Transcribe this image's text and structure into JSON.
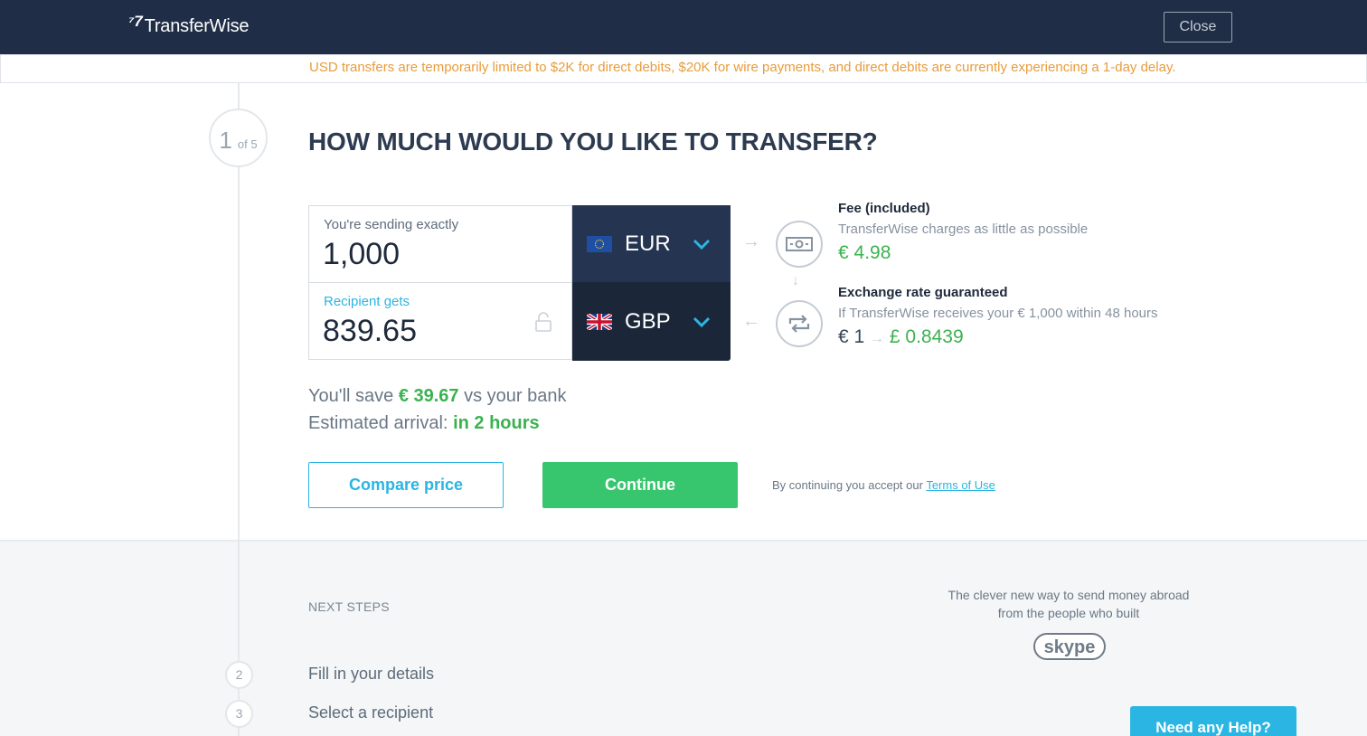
{
  "header": {
    "logo_mark": "⁷7",
    "logo_text": "TransferWise",
    "close_label": "Close"
  },
  "notice": "USD transfers are temporarily limited to $2K for direct debits, $20K for wire payments, and direct debits are currently experiencing a 1-day delay.",
  "step": {
    "current": "1",
    "of": "of 5"
  },
  "heading": "HOW MUCH WOULD YOU LIKE TO TRANSFER?",
  "calculator": {
    "send_label": "You're sending exactly",
    "send_amount": "1,000",
    "send_currency": "EUR",
    "recv_label": "Recipient gets",
    "recv_amount": "839.65",
    "recv_currency": "GBP"
  },
  "fee": {
    "title": "Fee (included)",
    "subtitle": "TransferWise charges as little as possible",
    "value": "€ 4.98"
  },
  "rate": {
    "title": "Exchange rate guaranteed",
    "subtitle": "If TransferWise receives your € 1,000 within 48 hours",
    "from": "€ 1",
    "to": "£ 0.8439"
  },
  "savings": {
    "prefix": "You'll save ",
    "amount": "€ 39.67",
    "suffix": " vs your bank"
  },
  "arrival": {
    "prefix": "Estimated arrival: ",
    "value": "in 2 hours"
  },
  "actions": {
    "compare_label": "Compare price",
    "continue_label": "Continue",
    "terms_prefix": "By continuing you accept our ",
    "terms_link": "Terms of Use"
  },
  "next_steps": {
    "heading": "NEXT STEPS",
    "items": [
      {
        "num": "2",
        "label": "Fill in your details"
      },
      {
        "num": "3",
        "label": "Select a recipient"
      }
    ]
  },
  "promo": {
    "line1": "The clever new way to send money abroad",
    "line2": "from the people who built",
    "brand": "skype"
  },
  "help_label": "Need any Help?",
  "colors": {
    "header_bg": "#1f2e46",
    "accent_blue": "#2ab5e3",
    "accent_green": "#37c66d",
    "notice_orange": "#e89c3c"
  }
}
